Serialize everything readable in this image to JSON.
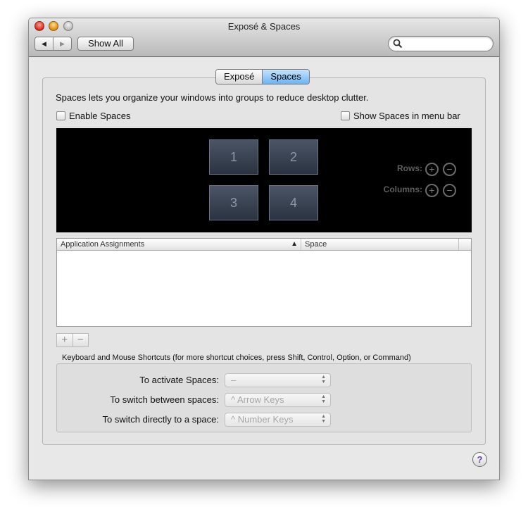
{
  "window": {
    "title": "Exposé & Spaces",
    "show_all_label": "Show All",
    "search": {
      "placeholder": "",
      "value": ""
    },
    "nav": {
      "back_glyph": "◀",
      "forward_glyph": "▶"
    }
  },
  "tabs": [
    {
      "label": "Exposé",
      "active": false
    },
    {
      "label": "Spaces",
      "active": true
    }
  ],
  "description": "Spaces lets you organize your windows into groups to reduce desktop clutter.",
  "enable_spaces": {
    "label": "Enable Spaces",
    "checked": false
  },
  "show_in_menubar": {
    "label": "Show Spaces in menu bar",
    "checked": false
  },
  "spaces_grid": {
    "tiles": [
      "1",
      "2",
      "3",
      "4"
    ],
    "rows_label": "Rows:",
    "columns_label": "Columns:",
    "add_glyph": "+",
    "remove_glyph": "−"
  },
  "assignments_table": {
    "columns": [
      "Application Assignments",
      "Space"
    ],
    "sort_indicator": "▲",
    "rows": []
  },
  "list_buttons": {
    "add": "+",
    "remove": "−"
  },
  "shortcuts": {
    "title": "Keyboard and Mouse Shortcuts (for more shortcut choices, press Shift, Control, Option, or Command)",
    "items": [
      {
        "label": "To activate Spaces:",
        "value": "–"
      },
      {
        "label": "To switch between spaces:",
        "value": "^ Arrow Keys"
      },
      {
        "label": "To switch directly to a space:",
        "value": "^ Number Keys"
      }
    ]
  },
  "help_label": "?",
  "colors": {
    "accent_tab": "#6bb3f2",
    "grid_background": "#000000",
    "close_button": "#d52c1f",
    "minimize_button": "#dc8c0c"
  }
}
